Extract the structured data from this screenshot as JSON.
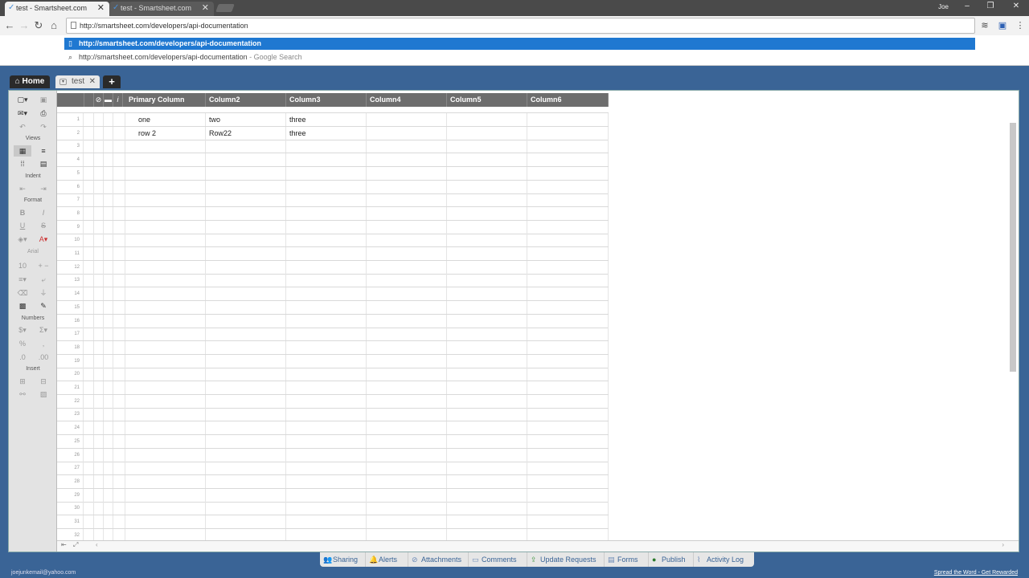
{
  "browser": {
    "tabs": [
      {
        "title": "test - Smartsheet.com",
        "active": true
      },
      {
        "title": "test - Smartsheet.com",
        "active": false
      }
    ],
    "user": "Joe",
    "address": "http://smartsheet.com/developers/api-documentation",
    "suggestions": [
      {
        "text": "http://smartsheet.com/developers/api-documentation",
        "suffix": ""
      },
      {
        "text": "http://smartsheet.com/developers/api-documentation",
        "suffix": " - Google Search"
      }
    ]
  },
  "app": {
    "home_label": "Home",
    "sheet_tab": "test",
    "sidebar_sections": [
      "Views",
      "Indent",
      "Format",
      "Numbers",
      "Insert"
    ],
    "font_name": "Arial",
    "font_size": "10"
  },
  "grid": {
    "columns": [
      "Primary Column",
      "Column2",
      "Column3",
      "Column4",
      "Column5",
      "Column6"
    ],
    "rows": [
      [
        "one",
        "two",
        "three",
        "",
        "",
        ""
      ],
      [
        "row 2",
        "Row22",
        "three",
        "",
        "",
        ""
      ]
    ],
    "row_count": 32
  },
  "bottom_bar": [
    "Sharing",
    "Alerts",
    "Attachments",
    "Comments",
    "Update Requests",
    "Forms",
    "Publish",
    "Activity Log"
  ],
  "footer": {
    "email": "joejunkemail@yahoo.com",
    "promo": "Spread the Word - Get Rewarded"
  },
  "colors": {
    "background": "#3a6496",
    "suggestion_highlight": "#1f78d1",
    "grid_header": "#6d6d6d"
  }
}
